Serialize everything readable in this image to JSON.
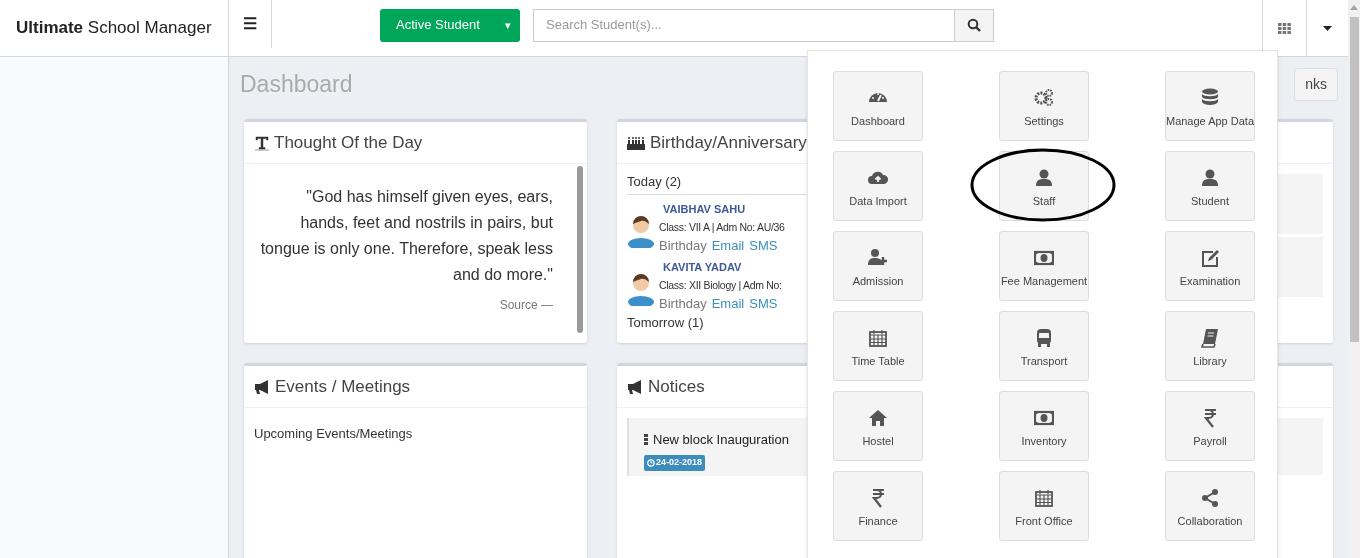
{
  "navbar": {
    "brand": "**Ultimate** School Manager",
    "menu_toggle": "☰",
    "student_filter": {
      "label": "Active Student",
      "caret": "▾"
    },
    "search": {
      "placeholder": "Search Student(s)..."
    }
  },
  "page": {
    "title": "Dashboard",
    "quick_links_button": "nks"
  },
  "thought_card": {
    "title": "Thought Of the Day",
    "quote": "\"God has himself given eyes, ears, hands, feet and nostrils in pairs, but tongue is only one. Therefore, speak less and do more.\"",
    "source": "Source —"
  },
  "birthday_card": {
    "title": "Birthday/Anniversary",
    "today": "Today (2)",
    "people": [
      {
        "name": "VAIBHAV SAHU",
        "details": "Class: VII A | Adm No: AU/36",
        "occasion": "Birthday",
        "links": [
          "Email",
          "SMS"
        ]
      },
      {
        "name": "KAVITA YADAV",
        "details": "Class: XII Biology | Adm No:",
        "occasion": "Birthday",
        "links": [
          "Email",
          "SMS"
        ]
      }
    ],
    "tomorrow": "Tomorrow (1)"
  },
  "events_card": {
    "title": "Events / Meetings",
    "subtitle": "Upcoming Events/Meetings"
  },
  "notices_card": {
    "title": "Notices",
    "notices": [
      {
        "title": "New block Inauguration",
        "date": "24-02-2018"
      }
    ]
  },
  "apps_menu": {
    "tiles": [
      {
        "label": "Dashboard",
        "highlighted": false
      },
      {
        "label": "Settings",
        "highlighted": false
      },
      {
        "label": "Manage App Data",
        "highlighted": false
      },
      {
        "label": "Data Import",
        "highlighted": false
      },
      {
        "label": "Staff",
        "highlighted": true
      },
      {
        "label": "Student",
        "highlighted": false
      },
      {
        "label": "Admission",
        "highlighted": false
      },
      {
        "label": "Fee Management",
        "highlighted": false
      },
      {
        "label": "Examination",
        "highlighted": false
      },
      {
        "label": "Time Table",
        "highlighted": false
      },
      {
        "label": "Transport",
        "highlighted": false
      },
      {
        "label": "Library",
        "highlighted": false
      },
      {
        "label": "Hostel",
        "highlighted": false
      },
      {
        "label": "Inventory",
        "highlighted": false
      },
      {
        "label": "Payroll",
        "highlighted": false
      },
      {
        "label": "Finance",
        "highlighted": false
      },
      {
        "label": "Front Office",
        "highlighted": false
      },
      {
        "label": "Collaboration",
        "highlighted": false
      }
    ]
  }
}
